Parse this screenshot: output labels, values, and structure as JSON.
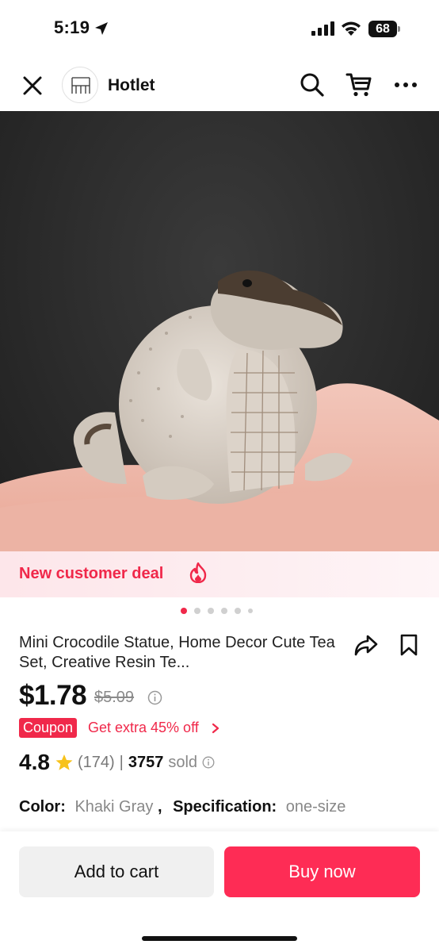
{
  "status_bar": {
    "time": "5:19",
    "battery": "68"
  },
  "header": {
    "shop_name": "Hotlet"
  },
  "deal_banner": {
    "text": "New customer deal"
  },
  "carousel": {
    "count": 6,
    "active": 0
  },
  "product": {
    "title": "Mini Crocodile Statue, Home Decor Cute Tea Set, Creative Resin Te...",
    "price": "$1.78",
    "original_price": "$5.09",
    "coupon_label": "Coupon",
    "coupon_text": "Get extra 45% off",
    "rating": "4.8",
    "review_count": "(174)",
    "separator": "|",
    "sold_count": "3757",
    "sold_label": "sold"
  },
  "variant": {
    "color_key": "Color:",
    "color_value": "Khaki Gray",
    "comma": ",",
    "spec_key": "Specification:",
    "spec_value": "one-size"
  },
  "actions": {
    "add_to_cart": "Add to cart",
    "buy_now": "Buy now"
  },
  "colors": {
    "accent": "#fe2c55",
    "deal_text": "#f0284a",
    "star": "#f7c21b"
  }
}
